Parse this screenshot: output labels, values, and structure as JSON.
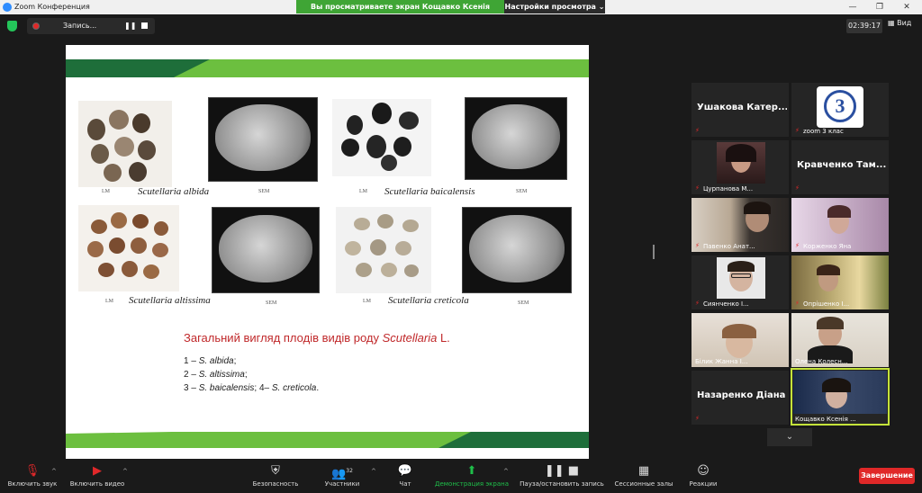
{
  "window": {
    "title": "Zoom Конференция",
    "share_banner": "Вы просматриваете экран Кощавко Ксенія Сергіївна",
    "view_options": "Настройки просмотра ⌄"
  },
  "topbar": {
    "recording_label": "Запись...",
    "timer": "02:39:17",
    "view_label": "Вид"
  },
  "slide": {
    "species_1": "Scutellaria albida",
    "species_2": "Scutellaria baicalensis",
    "species_3": "Scutellaria altissima",
    "species_4": "Scutellaria creticola",
    "lm": "LM",
    "sem": "SEM",
    "title_prefix": "Загальний вигляд плодів видів роду ",
    "title_genus": "Scutellaria",
    "title_suffix": " L.",
    "legend": [
      {
        "num": "1 – ",
        "name": "S. albida",
        "rest": ";"
      },
      {
        "num": " 2 – ",
        "name": "S. altissima",
        "rest": ";"
      },
      {
        "num": "3 – ",
        "name": "S. baicalensis",
        "rest": "; 4– "
      }
    ],
    "legend_last_name": "S. creticola",
    "legend_last_rest": "."
  },
  "participants": [
    {
      "name": "Ушакова Катер...",
      "kind": "name-only",
      "muted": true
    },
    {
      "name": "zoom 3 клас",
      "kind": "logo",
      "muted": true
    },
    {
      "name": "Цурпанова М...",
      "kind": "video",
      "muted": true
    },
    {
      "name": "Кравченко Там...",
      "kind": "name-only",
      "muted": true
    },
    {
      "name": "Павенко Анат...",
      "kind": "video",
      "muted": true
    },
    {
      "name": "Корженко Яна",
      "kind": "video",
      "muted": true
    },
    {
      "name": "Сиянченко І...",
      "kind": "video",
      "muted": true
    },
    {
      "name": "Опрішенко І...",
      "kind": "video",
      "muted": true
    },
    {
      "name": "Білик Жанна І...",
      "kind": "video",
      "muted": false
    },
    {
      "name": "Олена Колесн...",
      "kind": "video",
      "muted": false
    },
    {
      "name": "Назаренко Діана",
      "kind": "name-only",
      "muted": true
    },
    {
      "name": "Кощавко Ксенія ...",
      "kind": "video",
      "muted": false
    }
  ],
  "toolbar": {
    "unmute": "Включить звук",
    "start_video": "Включить видео",
    "security": "Безопасность",
    "participants": "Участники",
    "participants_count": "32",
    "chat": "Чат",
    "share_screen": "Демонстрация экрана",
    "pause_record": "Пауза/остановить запись",
    "breakout": "Сессионные залы",
    "reactions": "Реакции",
    "end": "Завершение"
  },
  "colors": {
    "accent_green": "#3fa535",
    "end_red": "#e02828",
    "active_speaker": "#c4e33a"
  }
}
